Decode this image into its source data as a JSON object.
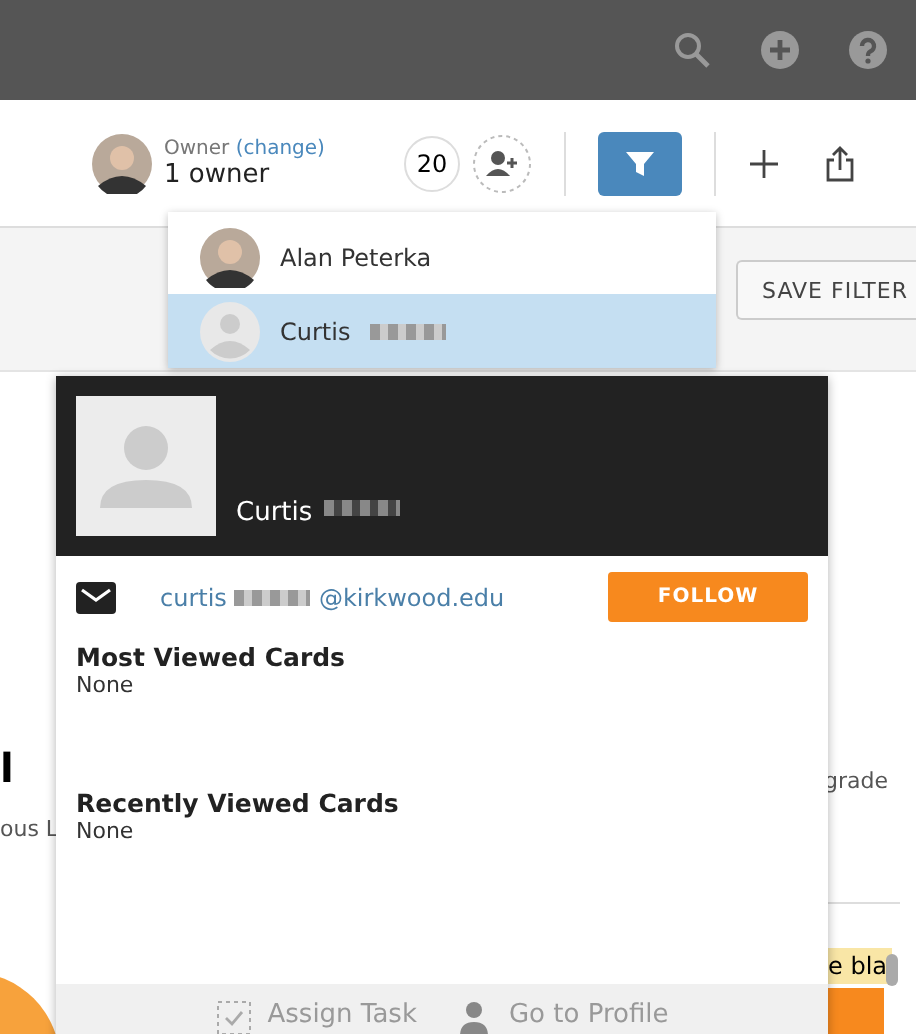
{
  "owner": {
    "label": "Owner",
    "change_link": "(change)",
    "value": "1 owner",
    "count": "20"
  },
  "toolbar": {
    "filter_active": true
  },
  "save_filter": "SAVE FILTER",
  "owner_dropdown": [
    {
      "name": "Alan Peterka",
      "photo": true,
      "selected": false
    },
    {
      "name": "Curtis",
      "photo": false,
      "selected": true
    }
  ],
  "profile_card": {
    "name": "Curtis",
    "email_start": "curtis",
    "email_end": "@kirkwood.edu",
    "follow": "FOLLOW",
    "sections": [
      {
        "title": "Most Viewed Cards",
        "value": "None"
      },
      {
        "title": "Recently Viewed Cards",
        "value": "None"
      }
    ],
    "actions": [
      {
        "kind": "task",
        "label": "Assign Task"
      },
      {
        "kind": "profile",
        "label": "Go to Profile"
      }
    ]
  },
  "background": {
    "left_heading": "l",
    "left_text": "ous L",
    "right_text": "grade",
    "banner_text": "e bla"
  }
}
